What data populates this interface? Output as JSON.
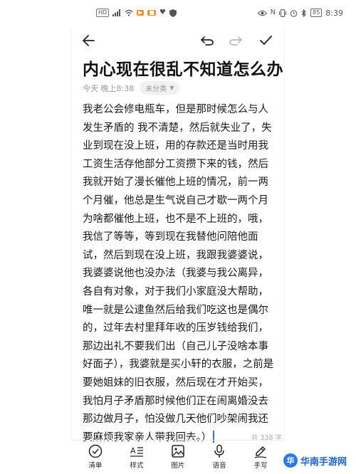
{
  "status_bar": {
    "left_icons": [
      "HD",
      "4G",
      "signal",
      "wifi",
      "app",
      "app",
      "heart",
      "shield"
    ],
    "right_icons": [
      "eye",
      "nfc",
      "vibrate",
      "alarm",
      "bluetooth"
    ],
    "battery": "85",
    "time": "8:39"
  },
  "toolbar": {
    "back_icon": "arrow-left-icon",
    "undo_icon": "undo-icon",
    "redo_icon": "redo-icon",
    "done_icon": "check-icon"
  },
  "note": {
    "title": "内心现在很乱不知道怎么办",
    "date": "今天 晚上8:38",
    "category": "未分类",
    "body": "我老公会修电瓶车，但是那时候怎么与人发生矛盾的 我不清楚，然后就失业了，失业到现在没上班，用的存款还是当时用我工资生活存他部分工资攒下来的钱，然后我就开始了漫长催他上班的情况，前一两个月催，他总是生气说自己才歇一两个月为啥都催他上班，也不是不上班的，哦，我信了等等，等到现在我替他问陪他面试，然后到现在没上班，我跟我婆婆说，我婆婆说他也没办法（我婆与我公离异，各自有对象，对于我们小家庭没大帮助，唯一就是公逮鱼然后给我们吃这也是偶尔的，过年去村里拜年收的压岁钱给我们，那边出礼不要我们出（自己儿子没啥本事好面子），我婆就是买小轩的衣服，之前是要她姐妹的旧衣服，然后现在才开始买，我怕月子矛盾那时候他们正在闹离婚没去那边做月子，怕没做几天他们吵架闹我还要麻烦我家亲人带我回去。）",
    "char_count": "共 338 字"
  },
  "bottom_bar": {
    "items": [
      {
        "label": "清单",
        "icon": "checklist-icon"
      },
      {
        "label": "样式",
        "icon": "text-style-icon"
      },
      {
        "label": "图片",
        "icon": "image-icon"
      },
      {
        "label": "语音",
        "icon": "microphone-icon"
      },
      {
        "label": "手写",
        "icon": "handwriting-icon"
      }
    ]
  },
  "watermark": {
    "text": "华南手游网"
  }
}
